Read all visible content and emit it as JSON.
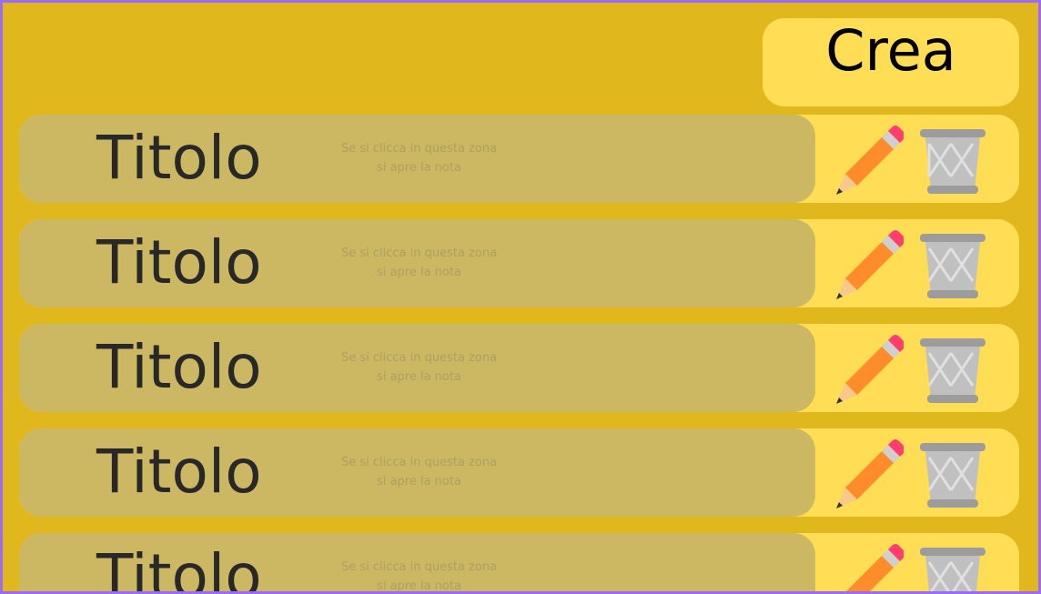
{
  "toolbar": {
    "create_label": "Crea"
  },
  "notes": [
    {
      "title": "Titolo",
      "hint_line1": "Se si clicca in questa zona",
      "hint_line2": "si apre la nota"
    },
    {
      "title": "Titolo",
      "hint_line1": "Se si clicca in questa zona",
      "hint_line2": "si apre la nota"
    },
    {
      "title": "Titolo",
      "hint_line1": "Se si clicca in questa zona",
      "hint_line2": "si apre la nota"
    },
    {
      "title": "Titolo",
      "hint_line1": "Se si clicca in questa zona",
      "hint_line2": "si apre la nota"
    },
    {
      "title": "Titolo",
      "hint_line1": "Se si clicca in questa zona",
      "hint_line2": "si apre la nota"
    }
  ],
  "icons": {
    "edit": "pencil-icon",
    "delete": "trash-icon"
  },
  "colors": {
    "background": "#e0b81e",
    "card": "#ffdd55",
    "open_area": "#ccb862",
    "pencil_body": "#ff8c2a",
    "pencil_eraser": "#ff3d6e",
    "trash": "#9c9c9c"
  }
}
